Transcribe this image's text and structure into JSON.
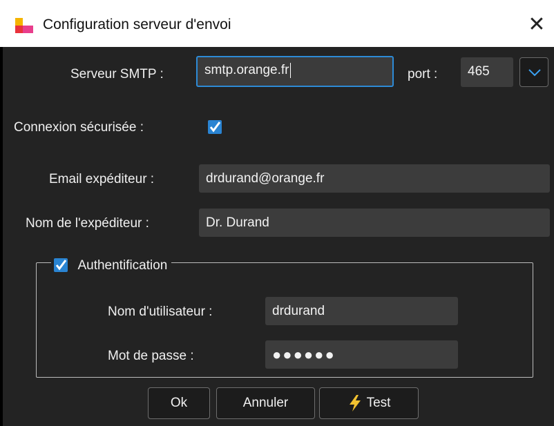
{
  "window": {
    "title": "Configuration serveur d'envoi",
    "close_glyph": "✕"
  },
  "smtp": {
    "label": "Serveur SMTP :",
    "value": "smtp.orange.fr",
    "port_label": "port :",
    "port_value": "465"
  },
  "secure": {
    "label": "Connexion sécurisée :",
    "checked": true
  },
  "sender_email": {
    "label": "Email expéditeur :",
    "value": "drdurand@orange.fr"
  },
  "sender_name": {
    "label": "Nom de l'expéditeur :",
    "value": "Dr. Durand"
  },
  "auth": {
    "legend_label": "Authentification",
    "checked": true,
    "username_label": "Nom d'utilisateur :",
    "username_value": "drdurand",
    "password_label": "Mot de passe :",
    "password_mask": "●●●●●●"
  },
  "buttons": {
    "ok": "Ok",
    "cancel": "Annuler",
    "test": "Test"
  },
  "colors": {
    "accent": "#2a84d2",
    "background": "#232323",
    "field": "#3c3c3c",
    "bolt": "#f2c230"
  },
  "icons": {
    "app": "app-logo-icon",
    "close": "close-icon",
    "dropdown": "chevron-down-icon",
    "check": "checkmark-icon",
    "test": "lightning-bolt-icon"
  }
}
